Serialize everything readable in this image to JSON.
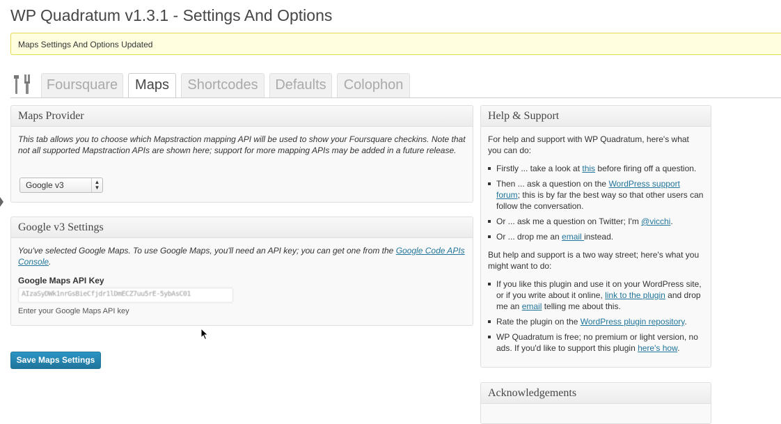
{
  "page": {
    "title": "WP Quadratum v1.3.1 - Settings And Options"
  },
  "notice": {
    "text": "Maps Settings And Options Updated"
  },
  "tabs": [
    {
      "label": "Foursquare",
      "active": false
    },
    {
      "label": "Maps",
      "active": true
    },
    {
      "label": "Shortcodes",
      "active": false
    },
    {
      "label": "Defaults",
      "active": false
    },
    {
      "label": "Colophon",
      "active": false
    }
  ],
  "maps_provider": {
    "title": "Maps Provider",
    "description": "This tab allows you to choose which Mapstraction mapping API will be used to show your Foursquare checkins. Note that not all supported Mapstraction APIs are shown here; support for more mapping APIs may be added in a future release.",
    "select_value": "Google v3"
  },
  "google_settings": {
    "title": "Google v3 Settings",
    "description_prefix": "You've selected Google Maps. To use Google Maps, you'll need an API key; you can get one from the ",
    "link_text": "Google Code APIs Console",
    "description_suffix": ".",
    "api_label": "Google Maps API Key",
    "api_value": "AIzaSyDWk1nrGsBieCfjdr1lDmECZ7uu5rE-5ybAsC01",
    "api_help": "Enter your Google Maps API key"
  },
  "save_button": {
    "label": "Save Maps Settings"
  },
  "help": {
    "title": "Help & Support",
    "intro": "For help and support with WP Quadratum, here's what you can do:",
    "item1": {
      "a": "Firstly ... take a look at ",
      "link": "this",
      "b": " before firing off a question."
    },
    "item2": {
      "a": "Then ... ask a question on the ",
      "link": "WordPress support forum",
      "b": "; this is by far the best way so that other users can follow the conversation."
    },
    "item3": {
      "a": "Or ... ask me a question on Twitter; I'm ",
      "link": "@vicchi",
      "b": "."
    },
    "item4": {
      "a": "Or ... drop me an ",
      "link": "email ",
      "b": "instead."
    },
    "intro2": "But help and support is a two way street; here's what you might want to do:",
    "item5": {
      "a": "If you like this plugin and use it on your WordPress site, or if you write about it online, ",
      "link": "link to the plugin",
      "b": " and drop me an ",
      "link2": "email",
      "c": " telling me about this."
    },
    "item6": {
      "a": "Rate the plugin on the ",
      "link": "WordPress plugin repository",
      "b": "."
    },
    "item7": {
      "a": "WP Quadratum is free; no premium or light version, no ads. If you'd like to support this plugin ",
      "link": "here's how",
      "b": "."
    }
  },
  "acknowledgements": {
    "title": "Acknowledgements"
  },
  "colors": {
    "accent": "#21759b",
    "notice_bg": "#ffffe0",
    "notice_border": "#e6db55"
  }
}
